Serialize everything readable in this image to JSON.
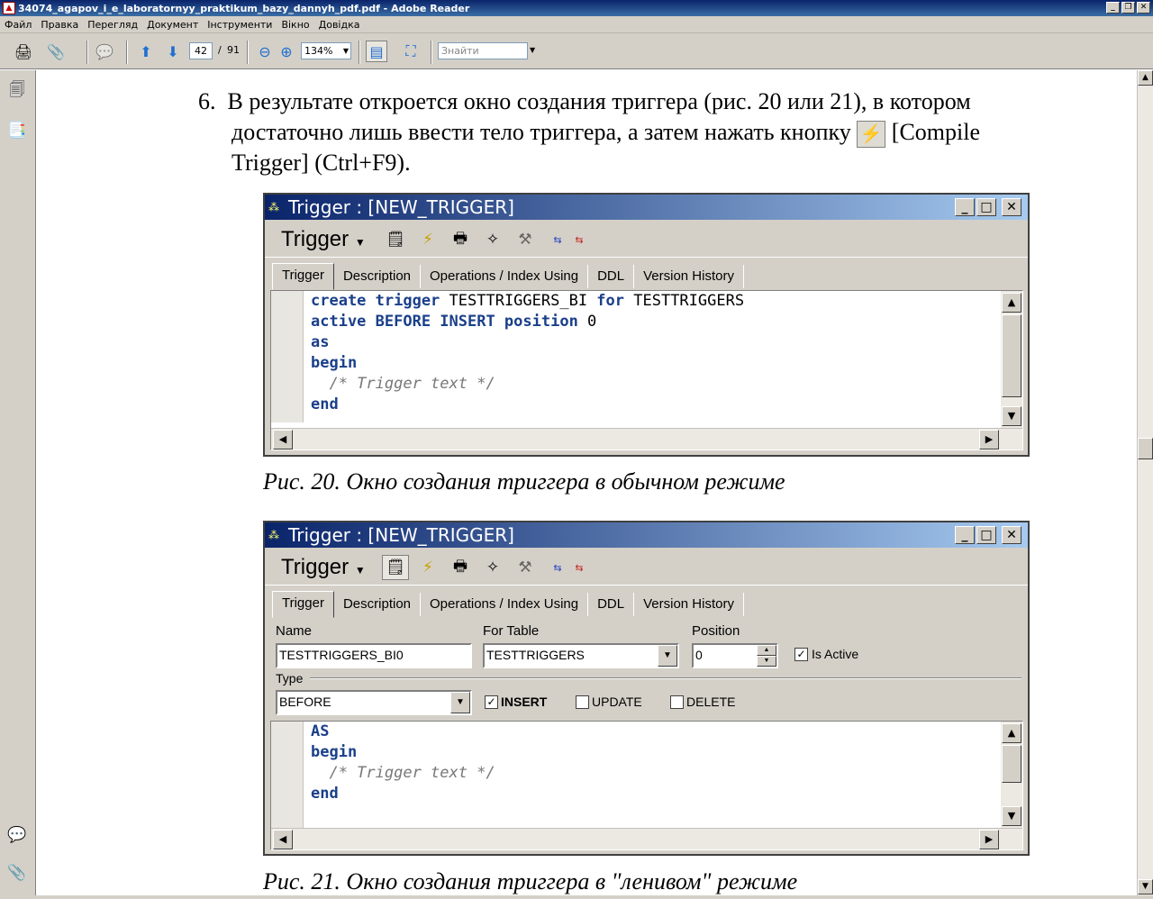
{
  "window": {
    "title": "34074_agapov_i_e_laboratornyy_praktikum_bazy_dannyh_pdf.pdf - Adobe Reader",
    "controls": [
      "_",
      "❐",
      "✕"
    ]
  },
  "menu": [
    "Файл",
    "Правка",
    "Перегляд",
    "Документ",
    "Інструменти",
    "Вікно",
    "Довідка"
  ],
  "toolbar": {
    "page_current": "42",
    "page_sep": "/",
    "page_total": "91",
    "zoom": "134%",
    "search_placeholder": "Знайти"
  },
  "doc": {
    "step_number": "6.",
    "paragraph_line1": "В результате откроется окно создания триггера (рис. 20 или 21), в котором",
    "paragraph_line2a": "достаточно лишь ввести тело триггера, а затем нажать кнопку",
    "paragraph_line2b": "[Compile",
    "paragraph_line3": "Trigger] (Ctrl+F9).",
    "caption1": "Рис. 20. Окно создания триггера в обычном режиме",
    "caption2": "Рис. 21. Окно создания триггера в \"ленивом\" режиме"
  },
  "fig1": {
    "title": "Trigger : [NEW_TRIGGER]",
    "dropdown": "Trigger",
    "tabs": [
      "Trigger",
      "Description",
      "Operations / Index Using",
      "DDL",
      "Version History"
    ],
    "code": {
      "l1_kw1": "create trigger",
      "l1_t1": " TESTTRIGGERS_BI ",
      "l1_kw2": "for",
      "l1_t2": " TESTTRIGGERS",
      "l2_kw": "active BEFORE INSERT position",
      "l2_t": " 0",
      "l3": "as",
      "l4": "begin",
      "l5": "  /* Trigger text */",
      "l6": "end"
    }
  },
  "fig2": {
    "title": "Trigger : [NEW_TRIGGER]",
    "dropdown": "Trigger",
    "tabs": [
      "Trigger",
      "Description",
      "Operations / Index Using",
      "DDL",
      "Version History"
    ],
    "name_label": "Name",
    "name_value": "TESTTRIGGERS_BI0",
    "table_label": "For Table",
    "table_value": "TESTTRIGGERS",
    "position_label": "Position",
    "position_value": "0",
    "is_active_label": "Is Active",
    "type_label": "Type",
    "type_value": "BEFORE",
    "insert_label": "INSERT",
    "update_label": "UPDATE",
    "delete_label": "DELETE",
    "code": {
      "l1": "AS",
      "l2": "begin",
      "l3": "  /* Trigger text */",
      "l4": "end"
    }
  },
  "left_panel_icons": [
    "pages-icon",
    "bookmarks-icon",
    "comments-icon",
    "attachments-icon"
  ]
}
